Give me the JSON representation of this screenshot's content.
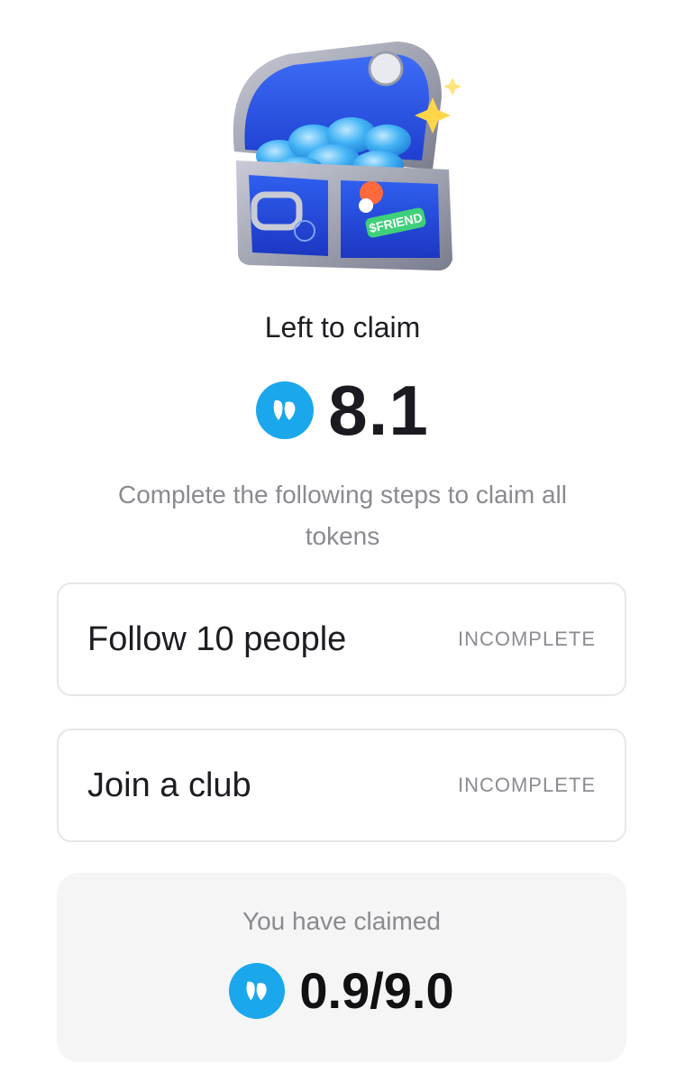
{
  "hero": {
    "image_icon": "treasure-chest-icon",
    "chest_sticker_text": "$FRIEND"
  },
  "claim": {
    "left_label": "Left to claim",
    "token_icon": "friend-token-icon",
    "left_amount": "8.1",
    "instructions": "Complete the following steps to claim all tokens"
  },
  "tasks": [
    {
      "title": "Follow 10 people",
      "status": "INCOMPLETE"
    },
    {
      "title": "Join a club",
      "status": "INCOMPLETE"
    }
  ],
  "claimed": {
    "label": "You have claimed",
    "amount": "0.9/9.0"
  },
  "colors": {
    "token_blue": "#1aa7ec",
    "chest_blue": "#2a5cf0",
    "card_border": "#e7e7ea",
    "claimed_bg": "#f5f5f6"
  }
}
